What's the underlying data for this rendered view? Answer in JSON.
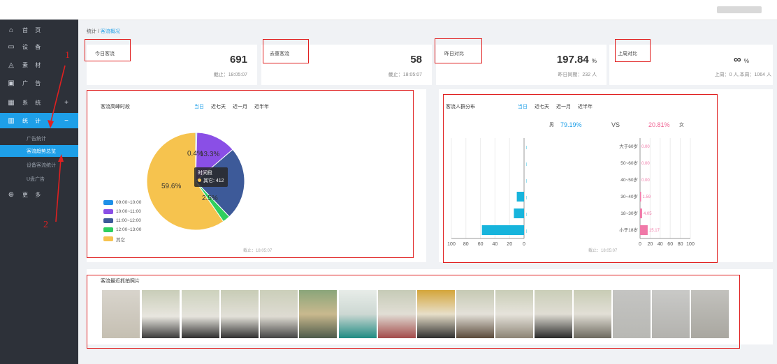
{
  "sidebar": {
    "items": [
      {
        "label": "首 页",
        "icon": "home-icon"
      },
      {
        "label": "设 备",
        "icon": "device-icon"
      },
      {
        "label": "素 材",
        "icon": "material-icon"
      },
      {
        "label": "广 告",
        "icon": "ad-icon"
      },
      {
        "label": "系 统",
        "icon": "system-icon",
        "arrow": "+"
      },
      {
        "label": "统 计",
        "icon": "stats-icon",
        "arrow": "−"
      },
      {
        "label": "更 多",
        "icon": "more-icon"
      }
    ],
    "sub_items": [
      "广告统计",
      "客流趋势总览",
      "设备客流统计",
      "U盘广告"
    ]
  },
  "breadcrumb": {
    "root": "统计",
    "sep": " / ",
    "current": "客流概况"
  },
  "stats": [
    {
      "title": "今日客流",
      "value": "691",
      "unit": "",
      "sub": "截止：18:05:07"
    },
    {
      "title": "去重客流",
      "value": "58",
      "unit": "",
      "sub": "截止：18:05:07"
    },
    {
      "title": "昨日对比",
      "value": "197.84",
      "unit": "%",
      "sub": "昨日同期：232 人"
    },
    {
      "title": "上周对比",
      "value": "∞",
      "unit": "%",
      "sub": "上周：0 人,本周：1064 人"
    }
  ],
  "peak": {
    "title": "客流高峰时段",
    "tabs": [
      "当日",
      "近七天",
      "近一月",
      "近半年"
    ],
    "tooltip_title": "时间段",
    "tooltip_value": "其它: 412",
    "deadline": "截止：18:05:07",
    "labels": {
      "big": "59.6%",
      "top": "0.4%",
      "top2": "13.3%",
      "small": "2.5%"
    }
  },
  "crowd": {
    "title": "客流人群分布",
    "tabs": [
      "当日",
      "近七天",
      "近一月",
      "近半年"
    ],
    "male_label": "男",
    "male_pct": "79.19%",
    "vs": "VS",
    "female_pct": "20.81%",
    "female_label": "女",
    "deadline": "截止：18:05:07"
  },
  "photos": {
    "title": "客流最近抓拍照片"
  },
  "annotations": {
    "n1": "1",
    "n2": "2"
  },
  "chart_data": [
    {
      "type": "pie",
      "title": "客流高峰时段",
      "categories": [
        "09:00~10:00",
        "10:00~11:00",
        "11:00~12:00",
        "12:00~13:00",
        "其它"
      ],
      "values": [
        0.4,
        13.3,
        24.2,
        2.5,
        59.6
      ],
      "colors": [
        "#1e90e8",
        "#8a4fe6",
        "#3d5a99",
        "#2fcf5f",
        "#f6c34e"
      ]
    },
    {
      "type": "bar",
      "title": "客流人群分布 男",
      "categories": [
        "大于60岁",
        "50~60岁",
        "40~50岁",
        "30~40岁",
        "18~30岁",
        "小于18岁"
      ],
      "values": [
        0,
        0,
        0,
        10,
        14,
        58
      ],
      "xlabels": [
        "100",
        "80",
        "60",
        "40",
        "20",
        "0"
      ],
      "xlim": [
        0,
        100
      ],
      "color": "#17b4dc"
    },
    {
      "type": "bar",
      "title": "客流人群分布 女",
      "categories": [
        "大于60岁",
        "50~60岁",
        "40~50岁",
        "30~40岁",
        "18~30岁",
        "小于18岁"
      ],
      "values": [
        0.0,
        0.0,
        0.0,
        1.59,
        4.05,
        15.17
      ],
      "value_labels": [
        "0.00",
        "0.00",
        "0.00",
        "1.59",
        "4.05",
        "15.17"
      ],
      "xlabels": [
        "0",
        "20",
        "40",
        "60",
        "80",
        "100"
      ],
      "xlim": [
        0,
        100
      ],
      "color": "#f079a8"
    }
  ]
}
